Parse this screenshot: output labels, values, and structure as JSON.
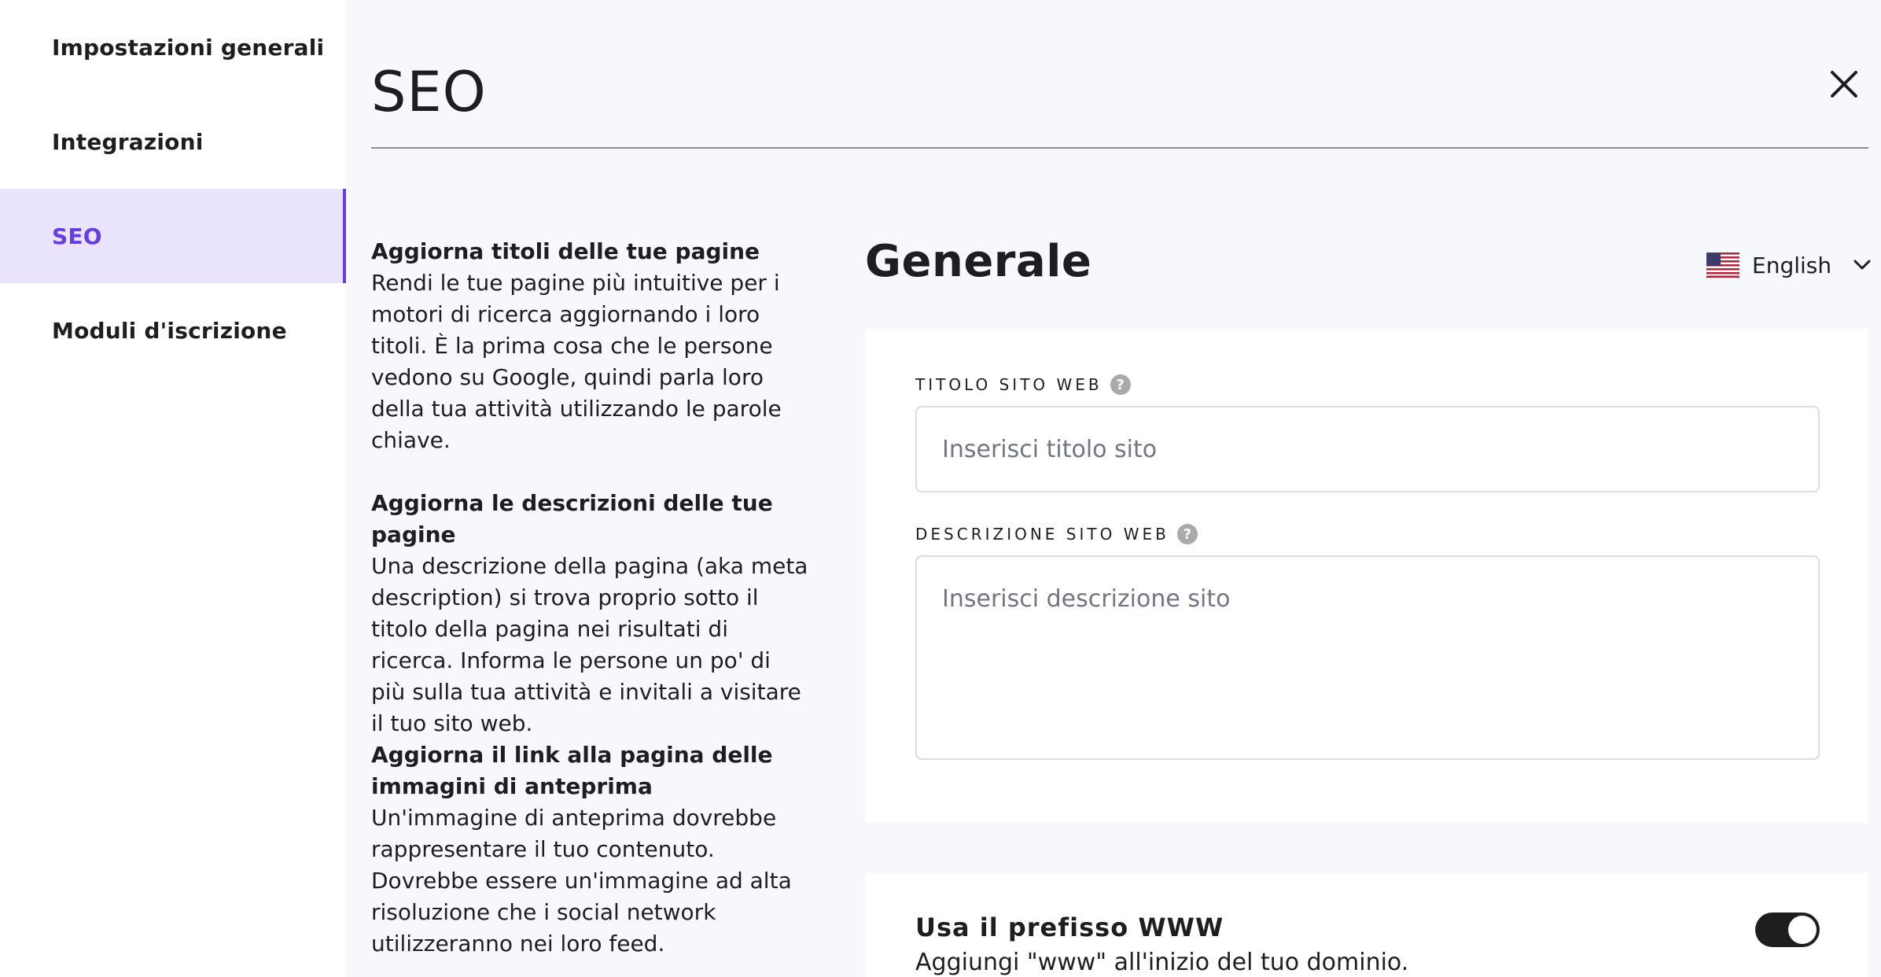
{
  "sidebar": {
    "items": [
      {
        "label": "Impostazioni generali"
      },
      {
        "label": "Integrazioni"
      },
      {
        "label": "SEO"
      },
      {
        "label": "Moduli d'iscrizione"
      }
    ],
    "active": "SEO"
  },
  "header": {
    "title": "SEO"
  },
  "help": [
    {
      "heading": "Aggiorna titoli delle tue pagine",
      "body": "Rendi le tue pagine più intuitive per i motori di ricerca aggiornando i loro titoli. È la prima cosa che le persone vedono su Google, quindi parla loro della tua attività utilizzando le parole chiave."
    },
    {
      "heading": "Aggiorna le descrizioni delle tue pagine",
      "body": "Una descrizione della pagina (aka meta description) si trova proprio sotto il titolo della pagina nei risultati di ricerca. Informa le persone un po' di più sulla tua attività e invitali a visitare il tuo sito web."
    },
    {
      "heading": "Aggiorna il link alla pagina delle immagini di anteprima",
      "body": "Un'immagine di anteprima dovrebbe rappresentare il tuo contenuto. Dovrebbe essere un'immagine ad alta risoluzione che i social network utilizzeranno nei loro feed."
    }
  ],
  "general": {
    "title": "Generale",
    "language": "English",
    "site_title": {
      "label": "TITOLO SITO WEB",
      "placeholder": "Inserisci titolo sito",
      "value": ""
    },
    "site_description": {
      "label": "DESCRIZIONE SITO WEB",
      "placeholder": "Inserisci descrizione sito",
      "value": ""
    }
  },
  "www_prefix": {
    "title": "Usa il prefisso WWW",
    "description": "Aggiungi \"www\" all'inizio del tuo dominio.",
    "enabled": true
  },
  "colors": {
    "accent": "#673de6",
    "active_bg": "#ebe4ff",
    "page_bg": "#f7f8fb",
    "text": "#1d1e20"
  },
  "icons": {
    "close": "close-icon",
    "help": "help-icon",
    "chevron": "chevron-down-icon",
    "flag": "us-flag-icon"
  }
}
